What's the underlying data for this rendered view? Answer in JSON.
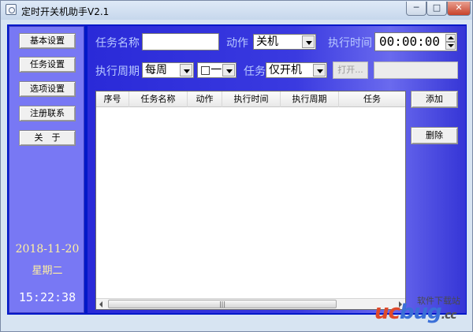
{
  "window": {
    "title": "定时开关机助手V2.1",
    "min": "─",
    "max": "□",
    "close": "✕"
  },
  "sidebar": {
    "buttons": [
      "基本设置",
      "任务设置",
      "选项设置",
      "注册联系",
      "关　于"
    ],
    "date": "2018-11-20",
    "weekday": "星期二",
    "clock": "15:22:38"
  },
  "form": {
    "task_name_label": "任务名称",
    "task_name_value": "",
    "action_label": "动作",
    "action_value": "关机",
    "exec_time_label": "执行时间",
    "exec_time_value": "00:00:00",
    "cycle_label": "执行周期",
    "cycle_value": "每周",
    "weekday_value": "□一",
    "task_label": "任务",
    "task_value": "仅开机",
    "open_button": "打开...",
    "path_value": ""
  },
  "table": {
    "columns": [
      "序号",
      "任务名称",
      "动作",
      "执行时间",
      "执行周期",
      "任务"
    ],
    "rows": [],
    "scroll_thumb": "|||"
  },
  "actions": {
    "add": "添加",
    "delete": "删除"
  },
  "watermark": {
    "text": "软件下载站",
    "logo_a": "uc",
    "logo_b": "bug",
    "logo_c": ".cc"
  },
  "colors": {
    "sidebar": "#7878f4",
    "main": "#2a2ad8",
    "label": "#b8c8ff",
    "date": "#fff0a0"
  }
}
